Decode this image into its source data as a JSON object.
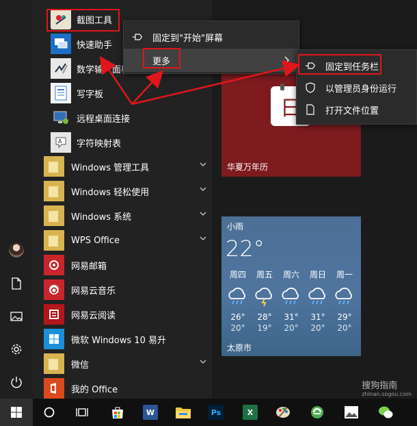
{
  "apps": [
    {
      "label": "截图工具",
      "icon": "snipping-tool-icon"
    },
    {
      "label": "快速助手",
      "icon": "quick-assist-icon"
    },
    {
      "label": "数学输入面板",
      "icon": "math-input-icon"
    },
    {
      "label": "写字板",
      "icon": "wordpad-icon"
    },
    {
      "label": "远程桌面连接",
      "icon": "remote-desktop-icon"
    },
    {
      "label": "字符映射表",
      "icon": "character-map-icon"
    }
  ],
  "folders": [
    {
      "label": "Windows 管理工具"
    },
    {
      "label": "Windows 轻松使用"
    },
    {
      "label": "Windows 系统"
    },
    {
      "label": "WPS Office"
    }
  ],
  "apps2": [
    {
      "label": "网易邮箱",
      "icon": "netease-mail-icon",
      "color": "#c8262b"
    },
    {
      "label": "网易云音乐",
      "icon": "netease-music-icon",
      "color": "#c8262b"
    },
    {
      "label": "网易云阅读",
      "icon": "netease-read-icon",
      "color": "#b3151a"
    },
    {
      "label": "微软 Windows 10 易升",
      "icon": "windows-upgrade-icon",
      "color": "#1c8fd8"
    },
    {
      "label": "微信",
      "icon": "wechat-folder-icon",
      "color": "#d8b350"
    },
    {
      "label": "我的 Office",
      "icon": "office-icon",
      "color": "#d94a1e"
    }
  ],
  "menu1": {
    "pin_start": "固定到\"开始\"屏幕",
    "more": "更多"
  },
  "menu2": {
    "pin_taskbar": "固定到任务栏",
    "run_admin": "以管理员身份运行",
    "open_location": "打开文件位置"
  },
  "tiles": {
    "calendar": {
      "label": "华夏万年历",
      "glyph": "日"
    },
    "weather": {
      "condition": "小雨",
      "temp": "22°",
      "city": "太原市",
      "days": [
        {
          "day": "周四",
          "hi": "26°",
          "lo": "20°",
          "icon": "rain"
        },
        {
          "day": "周五",
          "hi": "28°",
          "lo": "19°",
          "icon": "thunder"
        },
        {
          "day": "周六",
          "hi": "31°",
          "lo": "20°",
          "icon": "rain"
        },
        {
          "day": "周日",
          "hi": "31°",
          "lo": "20°",
          "icon": "rain"
        },
        {
          "day": "周一",
          "hi": "29°",
          "lo": "20°",
          "icon": "rain"
        }
      ]
    }
  },
  "watermark": {
    "brand": "搜狗指南",
    "url": "zhinan.sogou.com"
  },
  "colors": {
    "highlight": "#e0161b",
    "calendar_tile": "#7d1b1f",
    "weather_tile": "#4f759f",
    "folder": "#d8b350"
  }
}
